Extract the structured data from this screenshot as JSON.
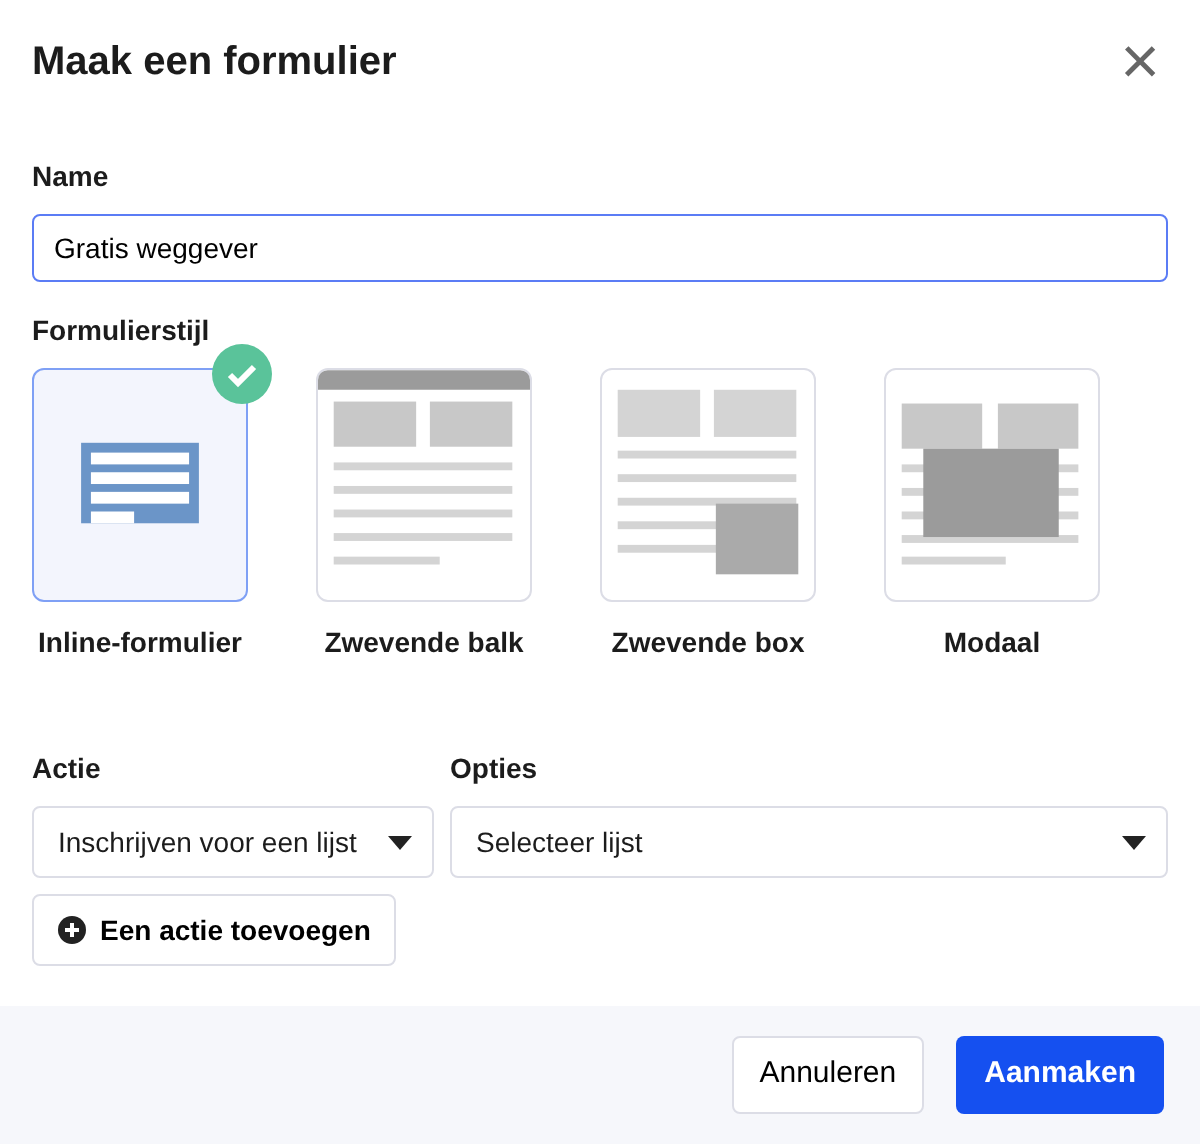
{
  "dialog": {
    "title": "Maak een formulier",
    "close": "×"
  },
  "name_field": {
    "label": "Name",
    "value": "Gratis weggever",
    "focused": true
  },
  "style_section": {
    "label": "Formulierstijl",
    "options": [
      {
        "kind": "inline",
        "label": "Inline-formulier",
        "selected": true
      },
      {
        "kind": "bar",
        "label": "Zwevende balk",
        "selected": false
      },
      {
        "kind": "box",
        "label": "Zwevende box",
        "selected": false
      },
      {
        "kind": "modal",
        "label": "Modaal",
        "selected": false
      }
    ]
  },
  "action": {
    "label": "Actie",
    "value": "Inschrijven voor een lijst"
  },
  "options": {
    "label": "Opties",
    "value": "Selecteer lijst"
  },
  "add_action_button": "Een actie toevoegen",
  "footer": {
    "cancel": "Annuleren",
    "create": "Aanmaken"
  }
}
